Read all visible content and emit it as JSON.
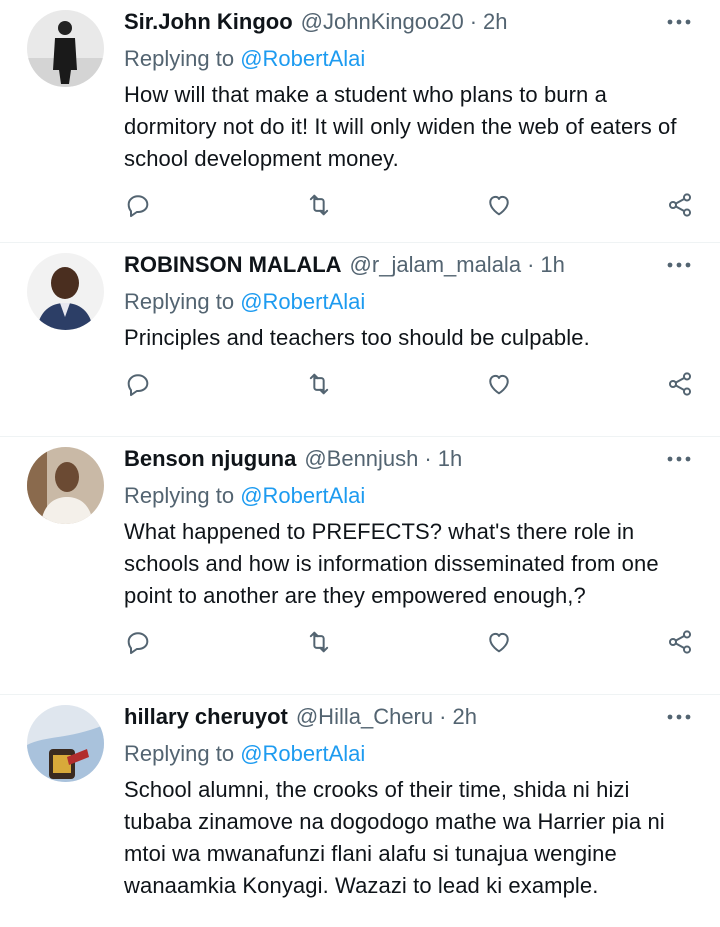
{
  "tweets": [
    {
      "name": "Sir.John Kingoo",
      "handle": "@JohnKingoo20",
      "time": "2h",
      "reply_prefix": "Replying to",
      "reply_to": "@RobertAlai",
      "text": "How will that make a student who plans to burn a dormitory not do it! It will only widen the web of eaters of school development money."
    },
    {
      "name": "ROBINSON MALALA",
      "handle": "@r_jalam_malala",
      "time": "1h",
      "reply_prefix": "Replying to",
      "reply_to": "@RobertAlai",
      "text": "Principles and teachers too should be culpable."
    },
    {
      "name": "Benson njuguna",
      "handle": "@Bennjush",
      "time": "1h",
      "reply_prefix": "Replying to",
      "reply_to": "@RobertAlai",
      "text": "What happened to PREFECTS? what's there role in schools and how is information disseminated from one point to another are they empowered enough,?"
    },
    {
      "name": "hillary cheruyot",
      "handle": "@Hilla_Cheru",
      "time": "2h",
      "reply_prefix": "Replying to",
      "reply_to": "@RobertAlai",
      "text": "School alumni, the crooks of their time, shida ni hizi tubaba zinamove na dogodogo mathe wa Harrier pia ni mtoi wa mwanafunzi flani alafu si tunajua wengine wanaamkia Konyagi. Wazazi to lead ki example."
    }
  ],
  "separator": "·",
  "icons": {
    "more": "more-horizontal-icon",
    "reply": "reply-bubble-icon",
    "retweet": "retweet-icon",
    "like": "heart-icon",
    "share": "share-icon"
  },
  "colors": {
    "link": "#1d9bf0",
    "secondary_text": "#536471",
    "primary_text": "#0f1419",
    "divider": "#eff3f4"
  }
}
